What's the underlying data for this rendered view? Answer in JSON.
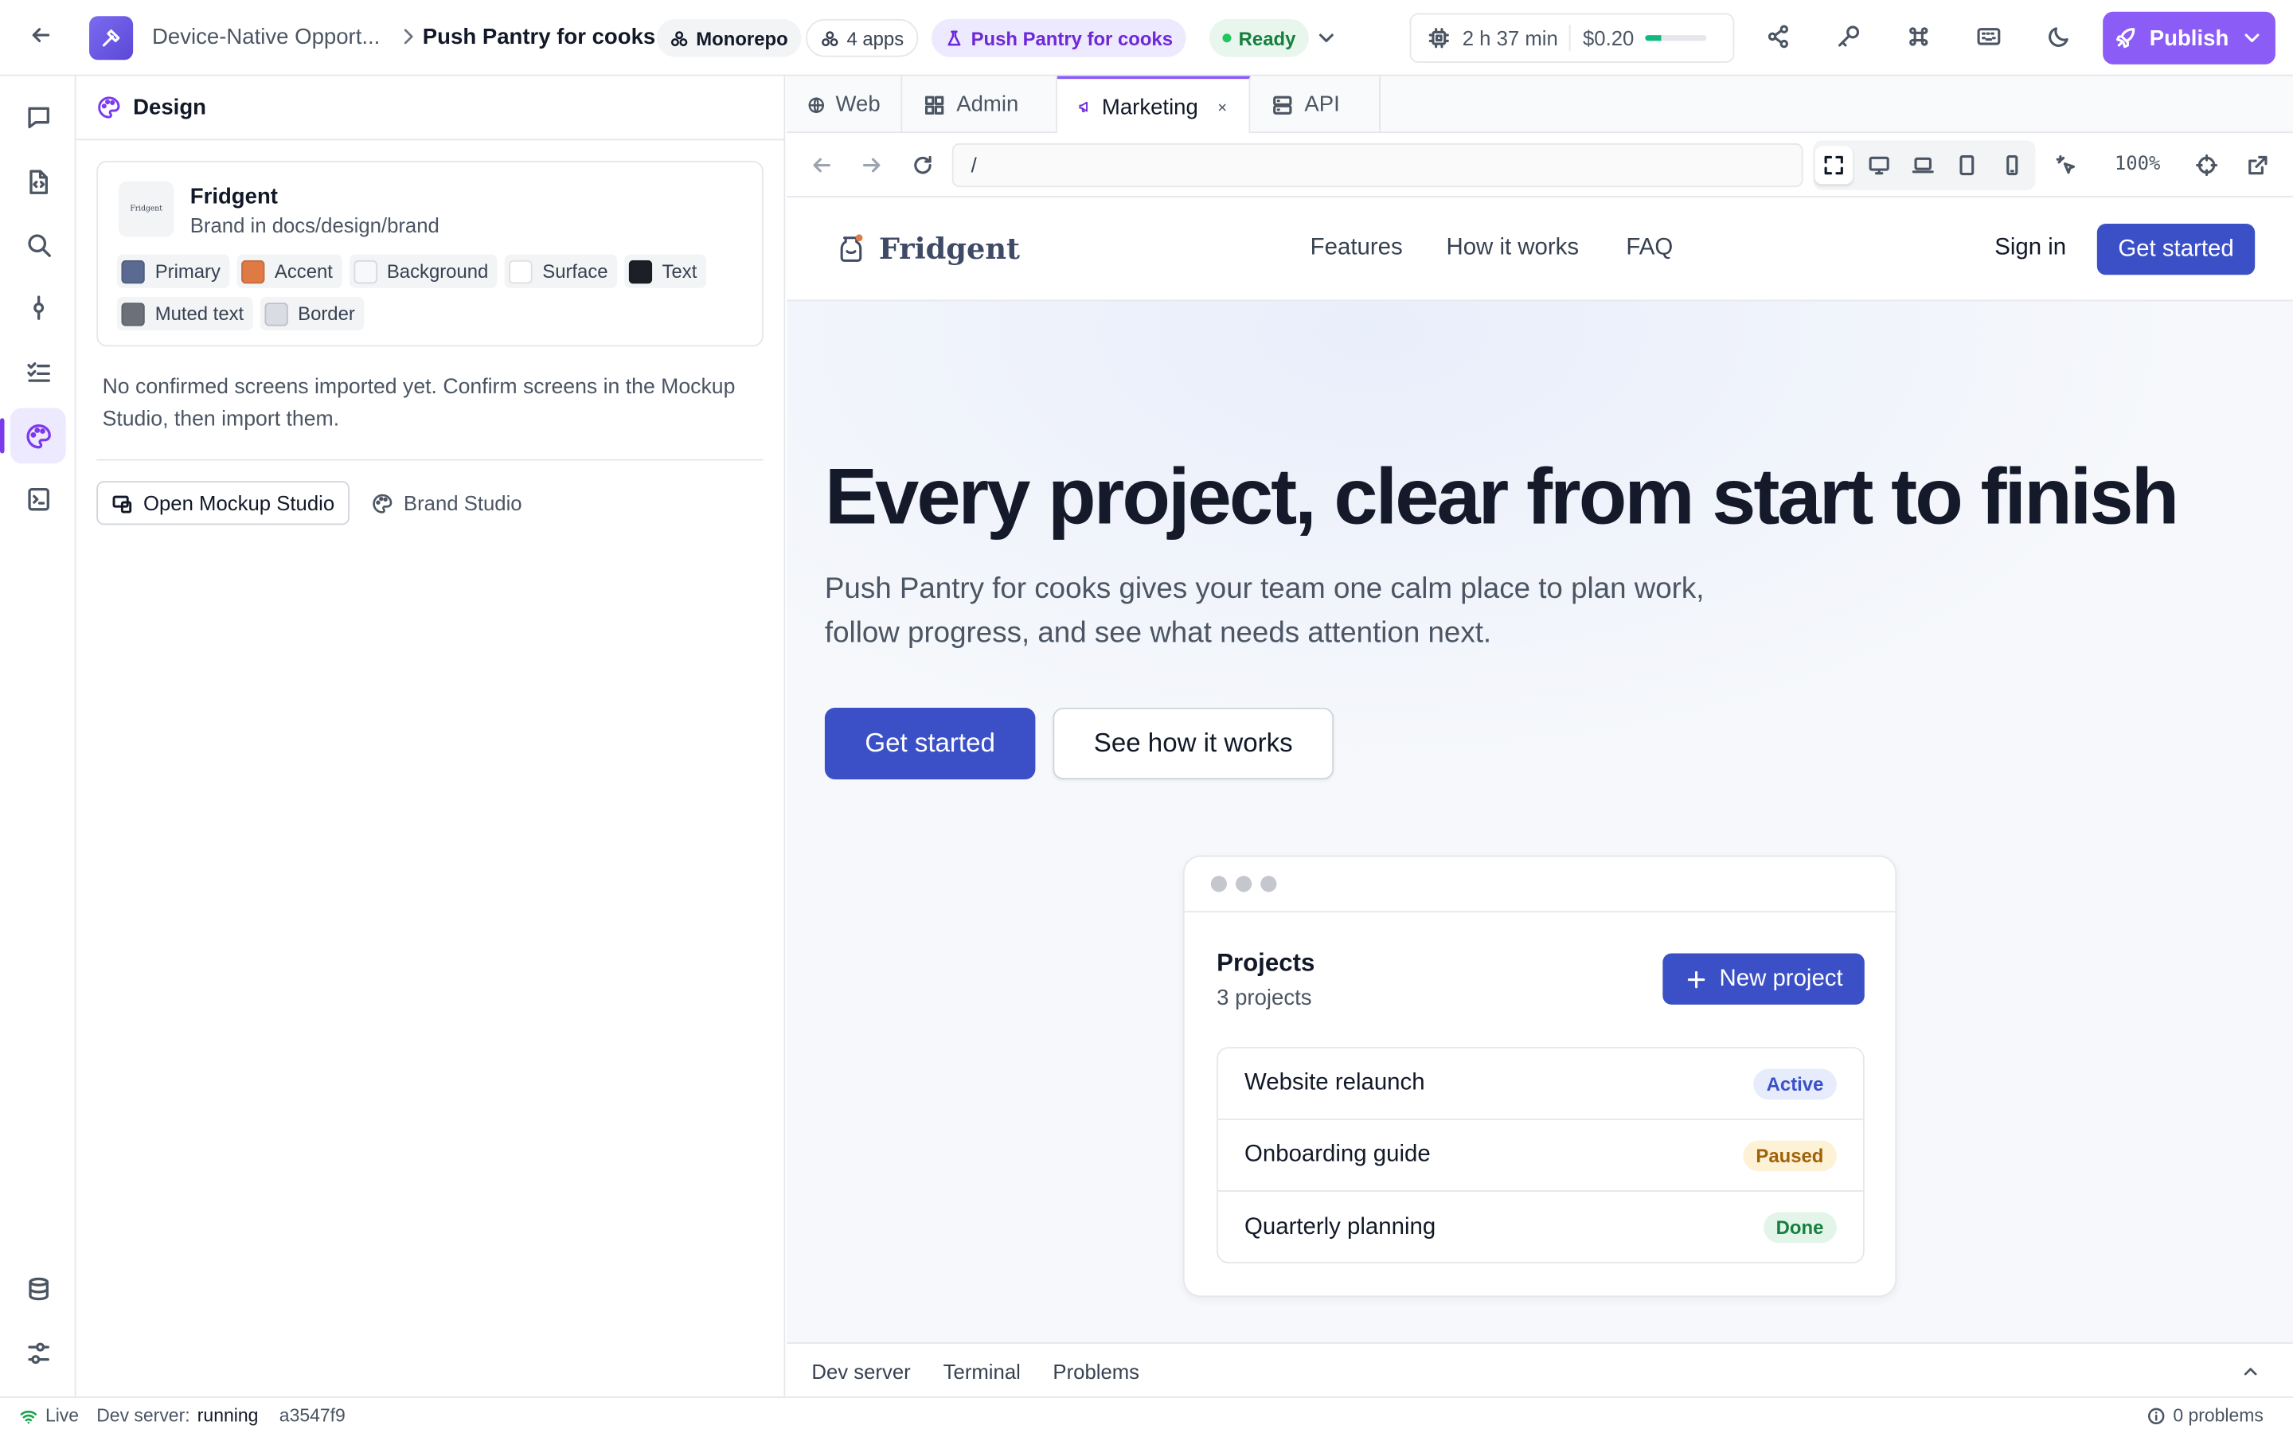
{
  "topbar": {
    "breadcrumb_parent": "Device-Native Opport...",
    "breadcrumb_current": "Push Pantry for cooks",
    "repo_badge": "Monorepo",
    "apps_badge": "4 apps",
    "project_badge": "Push Pantry for cooks",
    "status_badge": "Ready",
    "duration": "2 h 37 min",
    "cost": "$0.20",
    "budget_progress": 0.25,
    "publish_label": "Publish"
  },
  "rail": {
    "items": [
      "chat-icon",
      "code-file-icon",
      "search-icon",
      "commit-icon",
      "checklist-icon",
      "palette-icon",
      "terminal-doc-icon"
    ],
    "active": "palette-icon",
    "bottom": [
      "database-icon",
      "settings-sliders-icon"
    ]
  },
  "design_panel": {
    "title": "Design",
    "brand": {
      "thumb_text": "Fridgent",
      "name": "Fridgent",
      "path": "Brand in docs/design/brand",
      "swatches": [
        {
          "label": "Primary",
          "color": "#5b6a90"
        },
        {
          "label": "Accent",
          "color": "#e07a45"
        },
        {
          "label": "Background",
          "color": "#f7f8fb"
        },
        {
          "label": "Surface",
          "color": "#ffffff"
        },
        {
          "label": "Text",
          "color": "#1c1f26"
        },
        {
          "label": "Muted text",
          "color": "#6b7079"
        },
        {
          "label": "Border",
          "color": "#d9dce3"
        }
      ]
    },
    "note": "No confirmed screens imported yet. Confirm screens in the Mockup Studio, then import them.",
    "open_mockup_label": "Open Mockup Studio",
    "brand_studio_label": "Brand Studio"
  },
  "tabs": [
    {
      "label": "Web",
      "icon": "globe-icon"
    },
    {
      "label": "Admin",
      "icon": "grid-icon"
    },
    {
      "label": "Marketing",
      "icon": "megaphone-icon",
      "active": true
    },
    {
      "label": "API",
      "icon": "server-icon"
    }
  ],
  "address_bar": {
    "url": "/",
    "zoom": "100%"
  },
  "site": {
    "logo_text": "Fridgent",
    "nav": [
      "Features",
      "How it works",
      "FAQ"
    ],
    "sign_in": "Sign in",
    "get_started": "Get started",
    "hero_title": "Every project, clear from start to finish",
    "hero_text": "Push Pantry for cooks gives your team one calm place to plan work, follow progress, and see what needs attention next.",
    "hero_primary": "Get started",
    "hero_secondary": "See how it works",
    "mockup": {
      "title": "Projects",
      "count": "3 projects",
      "new_label": "New project",
      "rows": [
        {
          "name": "Website relaunch",
          "status": "Active"
        },
        {
          "name": "Onboarding guide",
          "status": "Paused"
        },
        {
          "name": "Quarterly planning",
          "status": "Done"
        }
      ]
    }
  },
  "bottom_tabs": [
    "Dev server",
    "Terminal",
    "Problems"
  ],
  "statusbar": {
    "live": "Live",
    "dev_server_label": "Dev server:",
    "dev_server_state": "running",
    "commit": "a3547f9",
    "problems": "0 problems"
  }
}
